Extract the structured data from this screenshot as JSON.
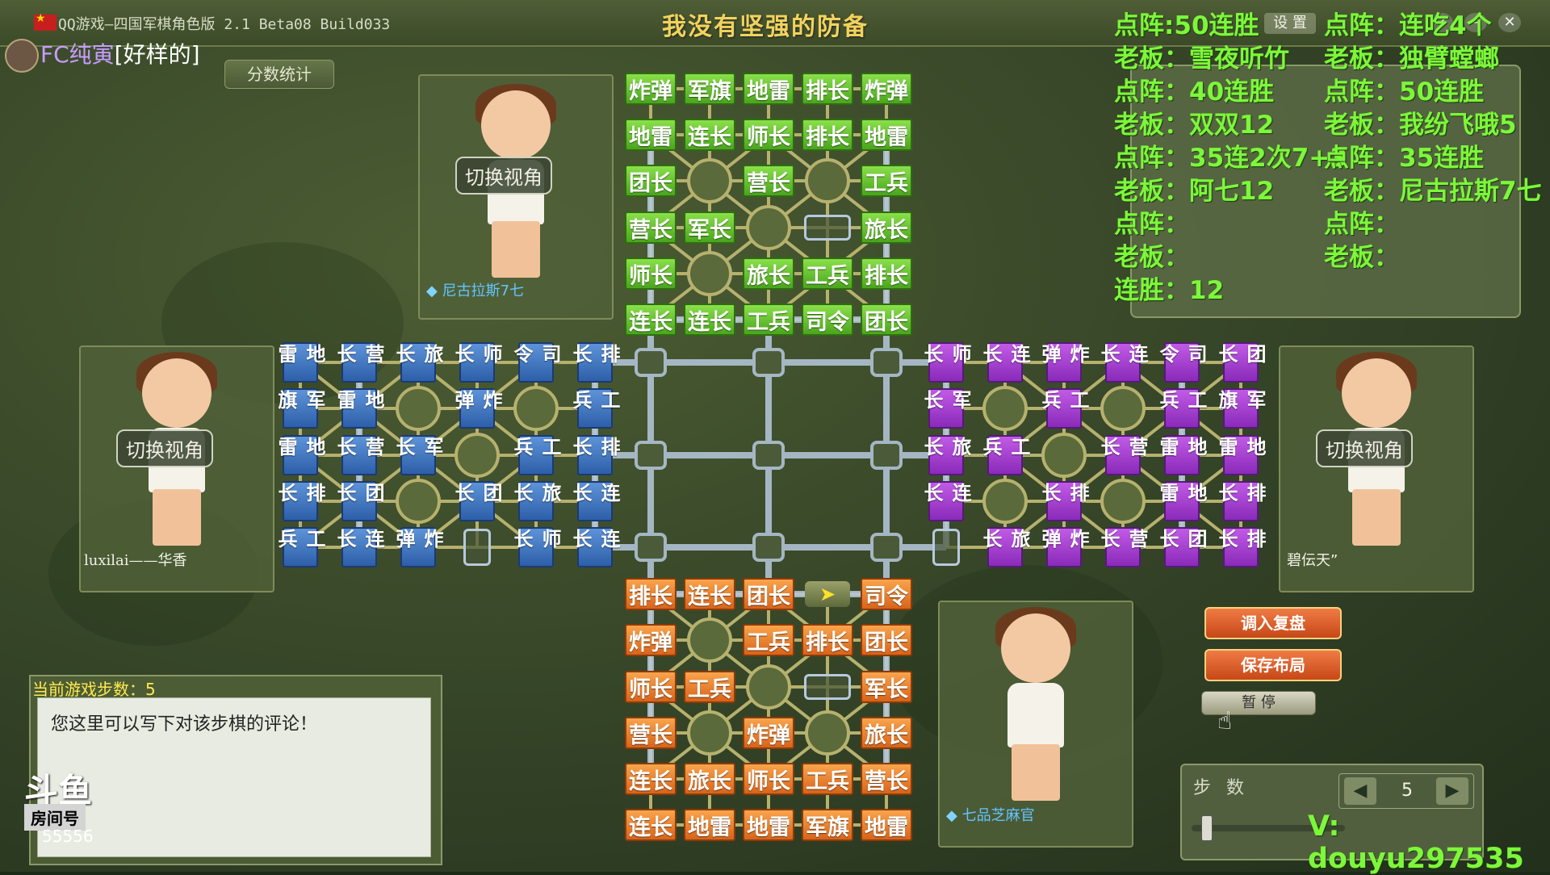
{
  "window": {
    "title": "QQ游戏—四国军棋角色版 2.1 Beta08 Build033",
    "banner": "我没有坚强的防备",
    "settings_label": "设 置"
  },
  "streamer": {
    "prefix": "FC纯寅",
    "tag": "[好样的]"
  },
  "score_button": "分数统计",
  "switch_view": "切换视角",
  "players": {
    "top": "尼古拉斯7七",
    "left": "luxilai——华香",
    "right": "碧伝天”",
    "bottom": "七品芝麻官"
  },
  "overlay": {
    "left_col": [
      "点阵:50连胜",
      "老板：雪夜听竹",
      "点阵：40连胜",
      "老板：双双12",
      "点阵：35连2次7+3",
      "老板：阿七12",
      "点阵：",
      "老板：",
      "连胜：12"
    ],
    "right_col": [
      "点阵：连吃4个",
      "老板：独臂螳螂",
      "点阵：50连胜",
      "老板：我纷飞哦5",
      "点阵：35连胜",
      "老板：尼古拉斯7七",
      "点阵：",
      "老板："
    ]
  },
  "board": {
    "green_top": [
      [
        "炸弹",
        "军旗",
        "地雷",
        "排长",
        "炸弹"
      ],
      [
        "地雷",
        "连长",
        "师长",
        "排长",
        "地雷"
      ],
      [
        "团长",
        "",
        "营长",
        "",
        "工兵"
      ],
      [
        "营长",
        "军长",
        "",
        "",
        "旅长"
      ],
      [
        "师长",
        "",
        "旅长",
        "工兵",
        "排长"
      ],
      [
        "连长",
        "连长",
        "工兵",
        "司令",
        "团长"
      ]
    ],
    "orange_bottom": [
      [
        "排长",
        "连长",
        "团长",
        "",
        "司令"
      ],
      [
        "炸弹",
        "",
        "工兵",
        "排长",
        "团长"
      ],
      [
        "师长",
        "工兵",
        "",
        "",
        "军长"
      ],
      [
        "营长",
        "",
        "炸弹",
        "",
        "旅长"
      ],
      [
        "连长",
        "旅长",
        "师长",
        "工兵",
        "营长"
      ],
      [
        "连长",
        "地雷",
        "地雷",
        "军旗",
        "地雷"
      ]
    ],
    "blue_left": [
      [
        "地雷",
        "营长",
        "旅长",
        "师长",
        "司令",
        "排长"
      ],
      [
        "军旗",
        "地雷",
        "",
        "炸弹",
        "",
        "工兵"
      ],
      [
        "地雷",
        "营长",
        "军长",
        "",
        "工兵",
        "排长"
      ],
      [
        "排长",
        "团长",
        "",
        "团长",
        "旅长",
        "连长"
      ],
      [
        "工兵",
        "连长",
        "炸弹",
        "",
        "师长",
        "连长"
      ]
    ],
    "purple_right": [
      [
        "师长",
        "连长",
        "炸弹",
        "连长",
        "司令",
        "团长"
      ],
      [
        "军长",
        "",
        "工兵",
        "",
        "工兵",
        "军旗"
      ],
      [
        "旅长",
        "工兵",
        "",
        "营长",
        "地雷",
        "地雷"
      ],
      [
        "连长",
        "",
        "排长",
        "",
        "地雷",
        "排长"
      ],
      [
        "",
        "旅长",
        "炸弹",
        "营长",
        "团长",
        "排长"
      ]
    ]
  },
  "comment": {
    "steps_label": "当前游戏步数：5",
    "text": "您这里可以写下对该步棋的评论！"
  },
  "douyu": {
    "logo": "斗鱼",
    "room_label": "房间号",
    "room_number": "55556"
  },
  "buttons": {
    "load_replay": "调入复盘",
    "save_layout": "保存布局",
    "pause": "暂  停"
  },
  "steps": {
    "title": "步 数",
    "value": "5"
  },
  "contact": "V:  douyu297535",
  "colors": {
    "green": "#4aa51d",
    "orange": "#d8641a",
    "blue": "#2d5fa8",
    "purple": "#8a2ab9",
    "overlay_text": "#7cf73a"
  }
}
